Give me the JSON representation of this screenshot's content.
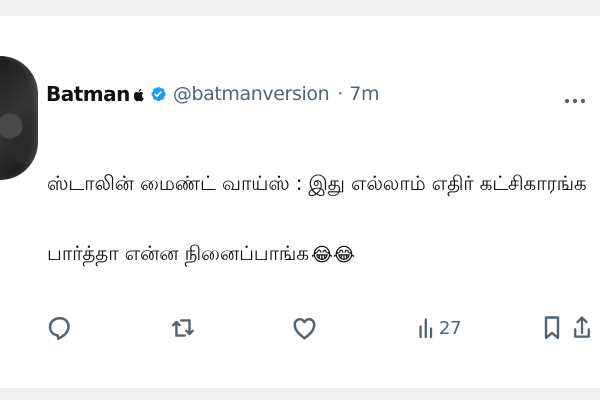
{
  "tweet": {
    "author": {
      "display_name": "Batman",
      "handle": "@batmanversion",
      "avatar_icon": "batman-avatar",
      "badge_icon": "verified-icon",
      "brand_icon": "apple-icon"
    },
    "meta": {
      "separator": "·",
      "time": "7m"
    },
    "text": {
      "line1": "ஸ்டாலின் மைண்ட் வாய்ஸ் : இது எல்லாம் எதிர் கட்சிகாரங்க",
      "line2": "பார்த்தா என்ன நினைப்பாங்க",
      "emoji": "😂😂"
    },
    "actions": {
      "reply_icon": "reply-icon",
      "retweet_icon": "retweet-icon",
      "like_icon": "like-icon",
      "views_icon": "views-icon",
      "views_count": "27",
      "bookmark_icon": "bookmark-icon",
      "share_icon": "share-icon"
    },
    "more_icon": "more-icon"
  },
  "colors": {
    "text_primary": "#111111",
    "text_secondary": "#536471",
    "verified_blue": "#1d9bf0",
    "background": "#ffffff",
    "frame_gray": "#f0f0f0"
  }
}
